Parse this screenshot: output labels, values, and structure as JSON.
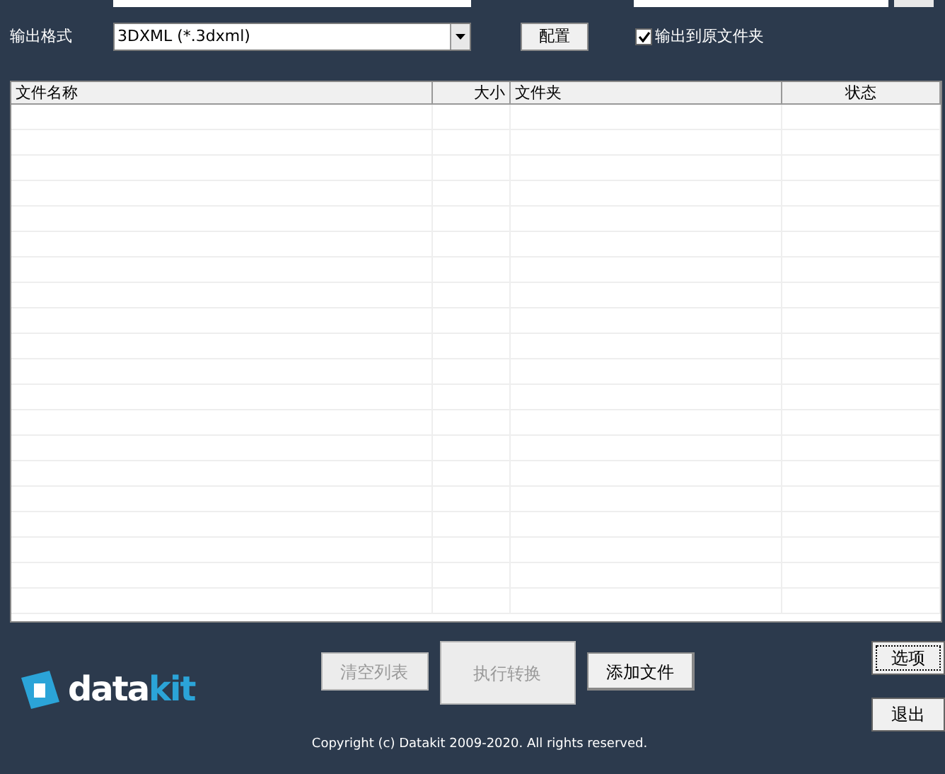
{
  "top_fields": [
    {
      "kind": "field"
    },
    {
      "kind": "field"
    }
  ],
  "format": {
    "label": "输出格式",
    "value": "3DXML (*.3dxml)",
    "config_button": "配置",
    "output_to_source": {
      "label": "输出到原文件夹",
      "checked": true
    }
  },
  "table": {
    "columns": [
      "文件名称",
      "大小",
      "文件夹",
      "状态"
    ]
  },
  "logo": {
    "parts": [
      "data",
      "kit"
    ]
  },
  "buttons": [
    {
      "label": "清空列表",
      "disabled": true,
      "kind": "small"
    },
    {
      "label": "执行转换",
      "disabled": true,
      "kind": "large"
    },
    {
      "label": "添加文件",
      "disabled": false,
      "kind": "small"
    }
  ],
  "side_buttons": [
    {
      "label": "选项",
      "focused": true
    },
    {
      "label": "退出",
      "focused": false
    }
  ],
  "copyright": "Copyright (c) Datakit 2009-2020. All rights reserved."
}
